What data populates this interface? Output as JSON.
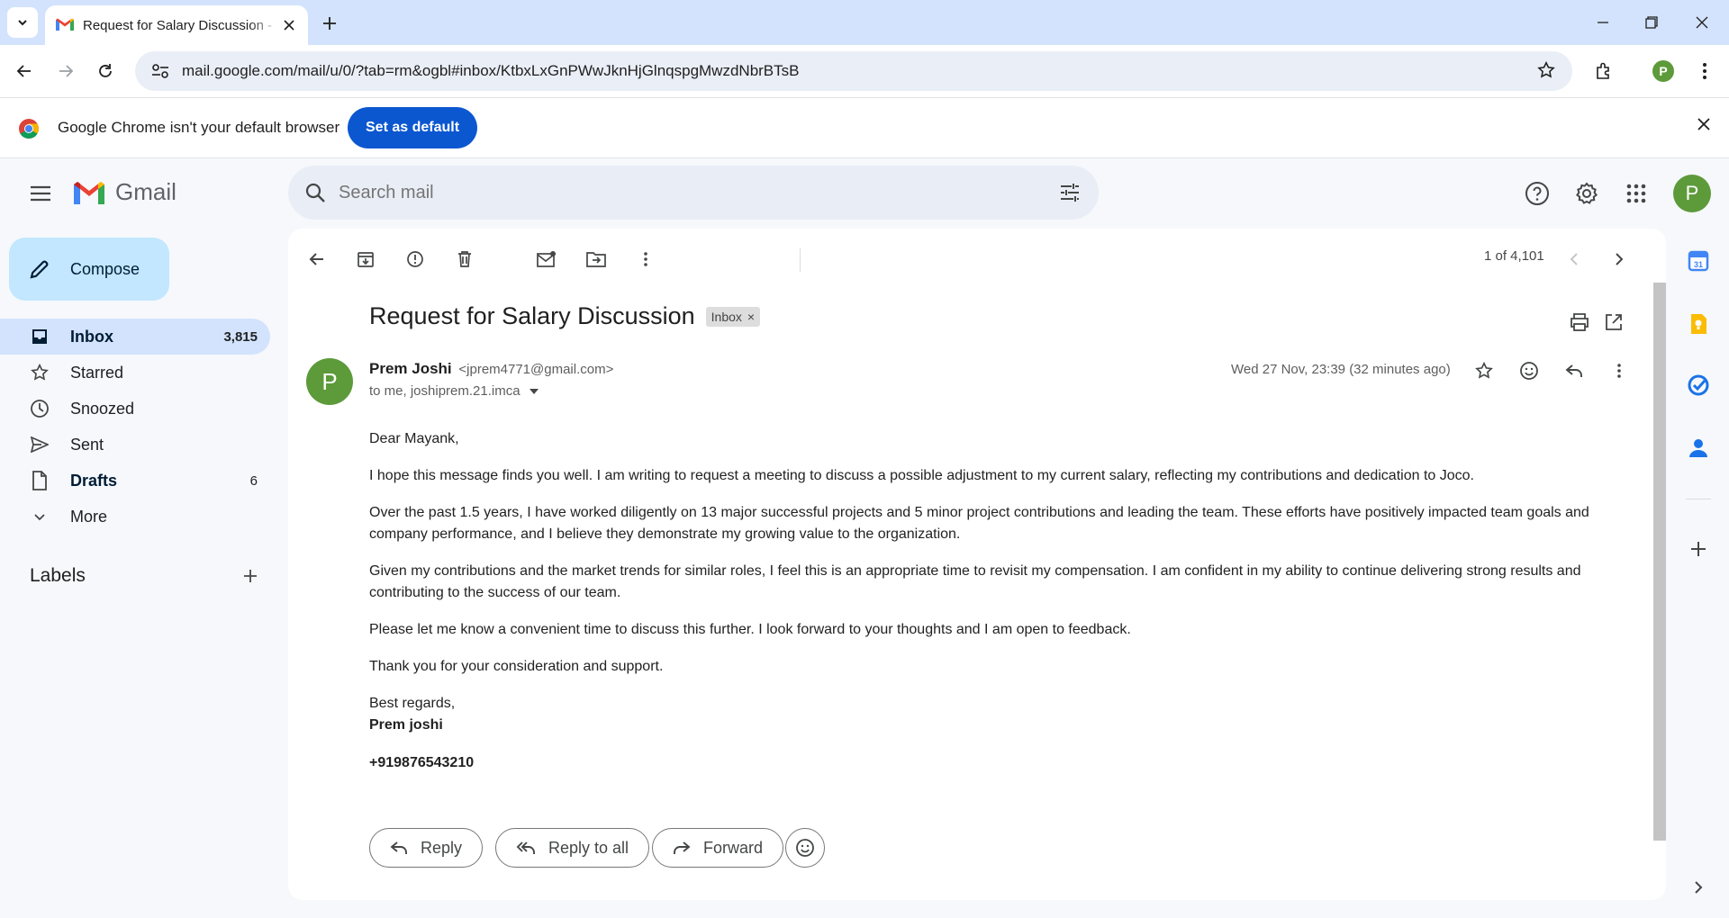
{
  "browser": {
    "tab_title": "Request for Salary Discussion - ",
    "url": "mail.google.com/mail/u/0/?tab=rm&ogbl#inbox/KtbxLxGnPWwJknHjGlnqspgMwzdNbrBTsB",
    "profile_initial": "P",
    "infobar_message": "Google Chrome isn't your default browser",
    "infobar_button": "Set as default"
  },
  "gmail": {
    "logo_text": "Gmail",
    "search_placeholder": "Search mail",
    "account_initial": "P"
  },
  "sidebar": {
    "compose": "Compose",
    "items": [
      {
        "label": "Inbox",
        "count": "3,815",
        "icon": "inbox-icon",
        "active": true
      },
      {
        "label": "Starred",
        "count": "",
        "icon": "star-icon"
      },
      {
        "label": "Snoozed",
        "count": "",
        "icon": "clock-icon"
      },
      {
        "label": "Sent",
        "count": "",
        "icon": "send-icon"
      },
      {
        "label": "Drafts",
        "count": "6",
        "icon": "draft-icon"
      },
      {
        "label": "More",
        "count": "",
        "icon": "chevron-down-icon"
      }
    ],
    "labels_header": "Labels"
  },
  "toolbar": {
    "pager": "1 of 4,101"
  },
  "email": {
    "subject": "Request for Salary Discussion",
    "label_chip": "Inbox",
    "sender_initial": "P",
    "sender_name": "Prem Joshi",
    "sender_email": "<jprem4771@gmail.com>",
    "recipients": "to me, joshiprem.21.imca",
    "date": "Wed 27 Nov, 23:39 (32 minutes ago)",
    "greeting": "Dear Mayank,",
    "paragraphs": [
      "I hope this message finds you well. I am writing to request a meeting to discuss a possible adjustment to my current salary, reflecting my contributions and dedication to Joco.",
      "Over the past 1.5 years, I have worked diligently on 13 major successful projects and 5 minor project contributions and leading the team. These efforts have positively impacted team goals and company performance, and I believe they demonstrate my growing value to the organization.",
      "Given my contributions and the market trends for similar roles, I feel this is an appropriate time to revisit my compensation. I am confident in my ability to continue delivering strong results and contributing to the success of our team.",
      "Please let me know a convenient time to discuss this further. I look forward to your thoughts and I am open to feedback.",
      "Thank you for your consideration and support."
    ],
    "closing": "Best regards,",
    "signature": "Prem joshi",
    "phone": "+919876543210"
  },
  "actions": {
    "reply": "Reply",
    "reply_all": "Reply to all",
    "forward": "Forward"
  },
  "colors": {
    "accent_blue": "#0b57d0",
    "compose_bg": "#c2e7ff",
    "active_nav": "#d3e3fd",
    "avatar_green": "#5d9a3a"
  }
}
